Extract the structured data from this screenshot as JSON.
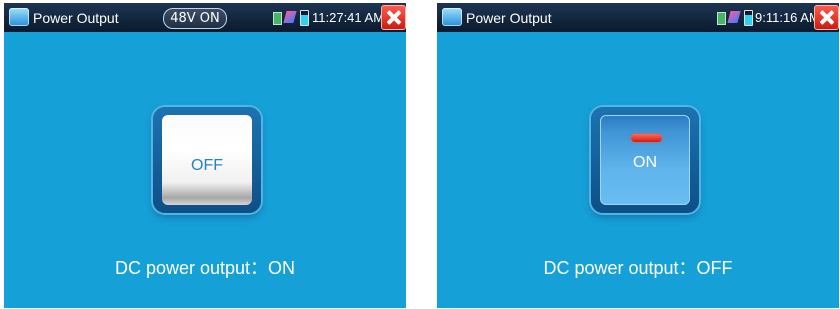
{
  "left_screen": {
    "app_title": "Power Output",
    "poe_badge": "48V ON",
    "clock": "11:27:41 AM",
    "switch_label": "OFF",
    "status_message": "DC power output：ON"
  },
  "right_screen": {
    "app_title": "Power Output",
    "clock": "9:11:16 AM",
    "switch_label": "ON",
    "status_message": "DC power output：OFF"
  },
  "icons": {
    "app": "power-output-app-icon",
    "sd_card": "sd-card-icon",
    "network": "network-icon",
    "battery": "battery-icon",
    "close": "close-icon",
    "indicator": "red-indicator-led"
  },
  "colors": {
    "background": "#16a0d8",
    "titlebar": "#0b1a2d",
    "close_button": "#d8271b",
    "indicator": "#e8281a"
  }
}
